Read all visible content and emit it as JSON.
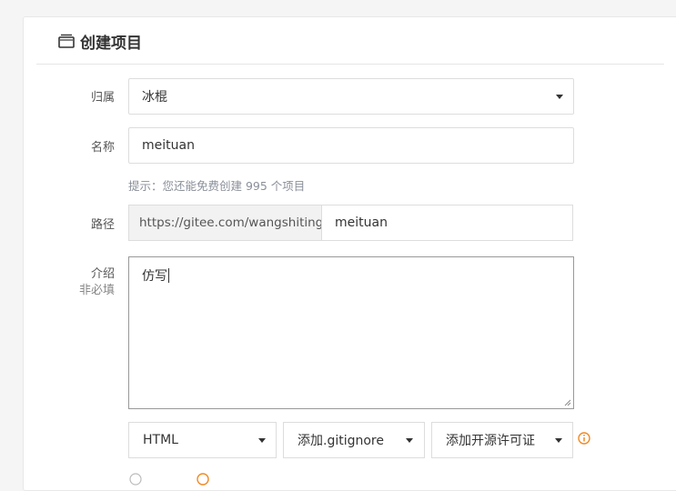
{
  "form": {
    "title": "创建项目",
    "owner": {
      "label": "归属",
      "value": "冰棍"
    },
    "name": {
      "label": "名称",
      "value": "meituan",
      "hint": "提示：您还能免费创建 995 个项目"
    },
    "path": {
      "label": "路径",
      "prefix": "https://gitee.com/wangshiting/",
      "value": "meituan"
    },
    "description": {
      "label": "介绍",
      "optional": "非必填",
      "value": "仿写"
    },
    "language_select": "HTML",
    "gitignore_select": "添加.gitignore",
    "license_select": "添加开源许可证"
  },
  "colors": {
    "info": "#f08a24",
    "hint": "#8a8f99",
    "border": "#dddddd"
  },
  "icons": {
    "title_icon": "window-icon",
    "info_icon": "info-circle-icon"
  }
}
